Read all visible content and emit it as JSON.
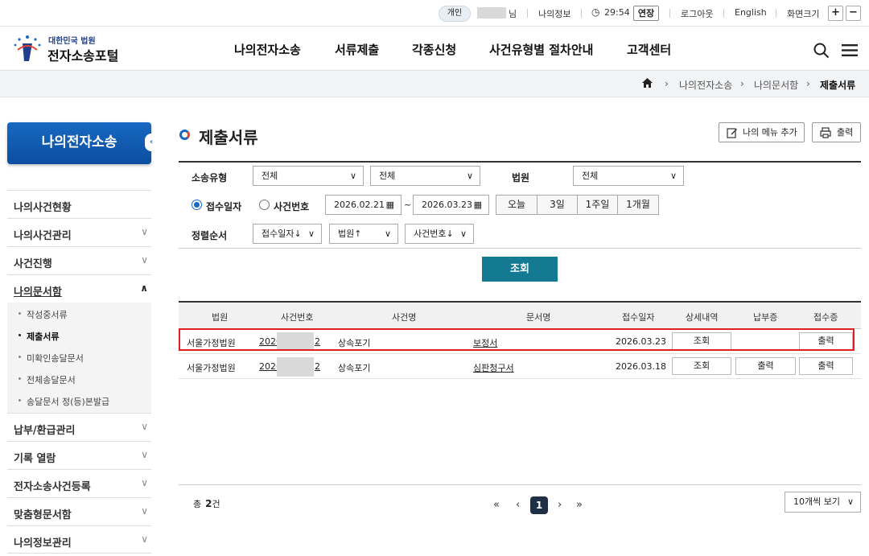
{
  "util": {
    "user_badge": "개인",
    "user_suffix": "님",
    "my_info": "나의정보",
    "timer": "29:54",
    "extend": "연장",
    "logout": "로그아웃",
    "language": "English",
    "zoom_label": "화면크기",
    "zoom_in": "+",
    "zoom_out": "−"
  },
  "header": {
    "logo_top": "대한민국 법원",
    "logo_main": "전자소송포털",
    "nav": [
      "나의전자소송",
      "서류제출",
      "각종신청",
      "사건유형별 절차안내",
      "고객센터"
    ]
  },
  "breadcrumb": [
    "나의전자소송",
    "나의문서함",
    "제출서류"
  ],
  "sidebar": {
    "title": "나의전자소송",
    "menu": [
      {
        "label": "나의사건현황",
        "chevron": ""
      },
      {
        "label": "나의사건관리",
        "chevron": "∨"
      },
      {
        "label": "사건진행",
        "chevron": "∨"
      },
      {
        "label": "나의문서함",
        "chevron": "∧"
      }
    ],
    "submenu": [
      "작성중서류",
      "제출서류",
      "미확인송달문서",
      "전체송달문서",
      "송달문서 정(등)본발급"
    ],
    "menu2": [
      {
        "label": "납부/환급관리",
        "chevron": "∨"
      },
      {
        "label": "기록 열람",
        "chevron": "∨"
      },
      {
        "label": "전자소송사건등록",
        "chevron": "∨"
      },
      {
        "label": "맞춤형문서함",
        "chevron": "∨"
      },
      {
        "label": "나의정보관리",
        "chevron": "∨"
      }
    ]
  },
  "page": {
    "title": "제출서류",
    "add_menu": "나의 메뉴 추가",
    "print": "출력"
  },
  "form": {
    "case_type_label": "소송유형",
    "case_type_1": "전체",
    "case_type_2": "전체",
    "court_label": "법원",
    "court_value": "전체",
    "radio_receipt": "접수일자",
    "radio_case": "사건번호",
    "date_from": "2026.02.21",
    "date_tilde": "~",
    "date_to": "2026.03.23",
    "quick": [
      "오늘",
      "3일",
      "1주일",
      "1개월"
    ],
    "sort_label": "정렬순서",
    "sort_1": "접수일자↓",
    "sort_2": "법원↑",
    "sort_3": "사건번호↓",
    "search": "조회"
  },
  "table": {
    "headers": [
      "법원",
      "사건번호",
      "사건명",
      "문서명",
      "접수일자",
      "상세내역",
      "납부증",
      "접수증"
    ],
    "rows": [
      {
        "court": "서울가정법원",
        "case_prefix": "2026",
        "case_suffix": "2",
        "case_name": "상속포기",
        "doc": "보정서",
        "date": "2026.03.23",
        "detail": "조회",
        "payment": "",
        "receipt": "출력"
      },
      {
        "court": "서울가정법원",
        "case_prefix": "2026",
        "case_suffix": "2",
        "case_name": "상속포기",
        "doc": "심판청구서",
        "date": "2026.03.18",
        "detail": "조회",
        "payment": "출력",
        "receipt": "출력"
      }
    ]
  },
  "footer": {
    "total_label": "총",
    "total_count": "2",
    "total_unit": "건",
    "first": "«",
    "prev": "‹",
    "page": "1",
    "next": "›",
    "last": "»",
    "per_page": "10개씩 보기"
  }
}
